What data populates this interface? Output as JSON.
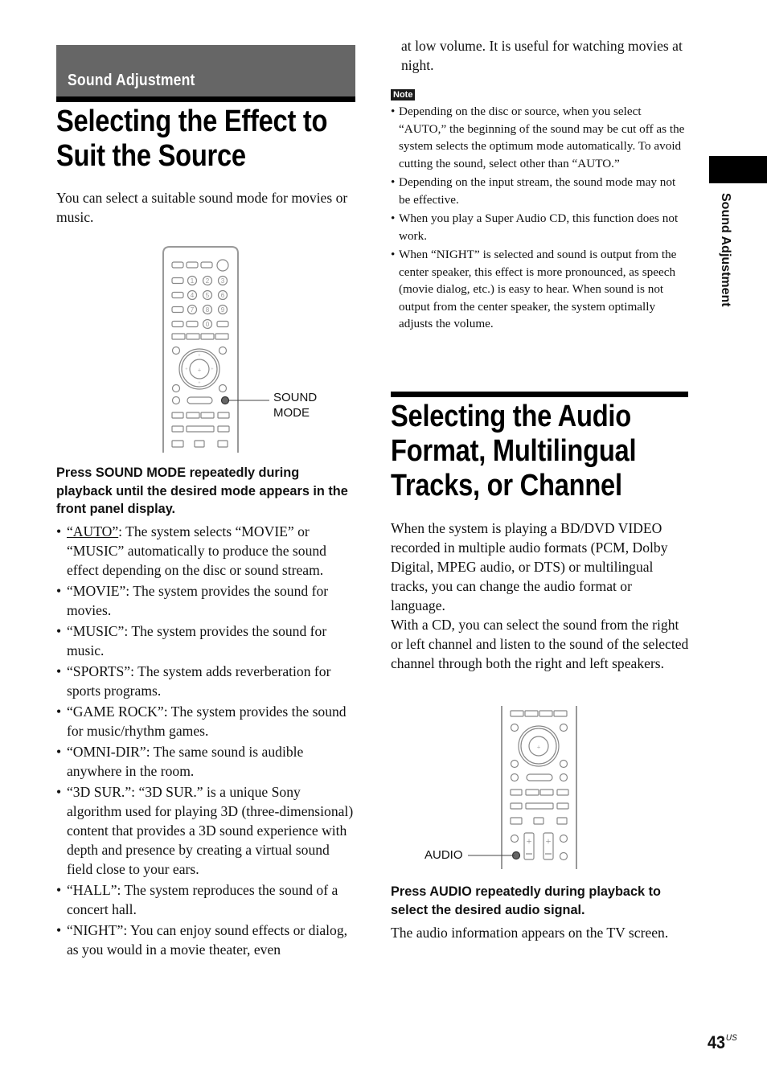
{
  "section": {
    "label": "Sound Adjustment",
    "side_tab_label": "Sound Adjustment"
  },
  "page": {
    "number": "43",
    "region_suffix": "US"
  },
  "article_1": {
    "title": "Selecting the Effect to Suit the Source",
    "title_lines": [
      "Selecting the Effect to",
      "Suit the Source"
    ],
    "intro": "You can select a suitable sound mode for movies or music.",
    "remote_callout": "SOUND MODE",
    "remote_callout_lines": [
      "SOUND",
      "MODE"
    ],
    "step": "Press SOUND MODE repeatedly during playback until the desired mode appears in the front panel display.",
    "modes": [
      {
        "name": "“AUTO”",
        "default": true,
        "desc": ": The system selects “MOVIE” or “MUSIC” automatically to produce the sound effect depending on the disc or sound stream."
      },
      {
        "name": "“MOVIE”",
        "default": false,
        "desc": ": The system provides the sound for movies."
      },
      {
        "name": "“MUSIC”",
        "default": false,
        "desc": ": The system provides the sound for music."
      },
      {
        "name": "“SPORTS”",
        "default": false,
        "desc": ": The system adds reverberation for sports programs."
      },
      {
        "name": "“GAME ROCK”",
        "default": false,
        "desc": ": The system provides the sound for music/rhythm games."
      },
      {
        "name": "“OMNI-DIR”",
        "default": false,
        "desc": ": The same sound is audible anywhere in the room."
      },
      {
        "name": "“3D SUR.”",
        "default": false,
        "desc": ": “3D SUR.” is a unique Sony algorithm used for playing 3D (three-dimensional) content that provides a 3D sound experience with depth and presence by creating a virtual sound field close to your ears."
      },
      {
        "name": "“HALL”",
        "default": false,
        "desc": ": The system reproduces the sound of a concert hall."
      },
      {
        "name": "“NIGHT”",
        "default": false,
        "desc": ": You can enjoy sound effects or dialog, as you would in a movie theater, even"
      }
    ],
    "night_continuation": "at low volume. It is useful for watching movies at night.",
    "note_label": "Note",
    "notes": [
      "Depending on the disc or source, when you select “AUTO,” the beginning of the sound may be cut off as the system selects the optimum mode automatically. To avoid cutting the sound, select other than “AUTO.”",
      "Depending on the input stream, the sound mode may not be effective.",
      "When you play a Super Audio CD, this function does not work.",
      "When “NIGHT” is selected and sound is output from the center speaker, this effect is more pronounced, as speech (movie dialog, etc.) is easy to hear. When sound is not output from the center speaker, the system optimally adjusts the volume."
    ]
  },
  "article_2": {
    "title": "Selecting the Audio Format, Multilingual Tracks, or Channel",
    "title_lines": [
      "Selecting the Audio",
      "Format, Multilingual",
      "Tracks, or Channel"
    ],
    "intro_p1": "When the system is playing a BD/DVD VIDEO recorded in multiple audio formats (PCM, Dolby Digital, MPEG audio, or DTS) or multilingual tracks, you can change the audio format or language.",
    "intro_p2": "With a CD, you can select the sound from the right or left channel and listen to the sound of the selected channel through both the right and left speakers.",
    "remote_callout": "AUDIO",
    "step": "Press AUDIO repeatedly during playback to select the desired audio signal.",
    "result": "The audio information appears on the TV screen."
  },
  "remote_1": {
    "number_keys": [
      "1",
      "2",
      "3",
      "4",
      "5",
      "6",
      "7",
      "8",
      "9",
      "0"
    ]
  }
}
